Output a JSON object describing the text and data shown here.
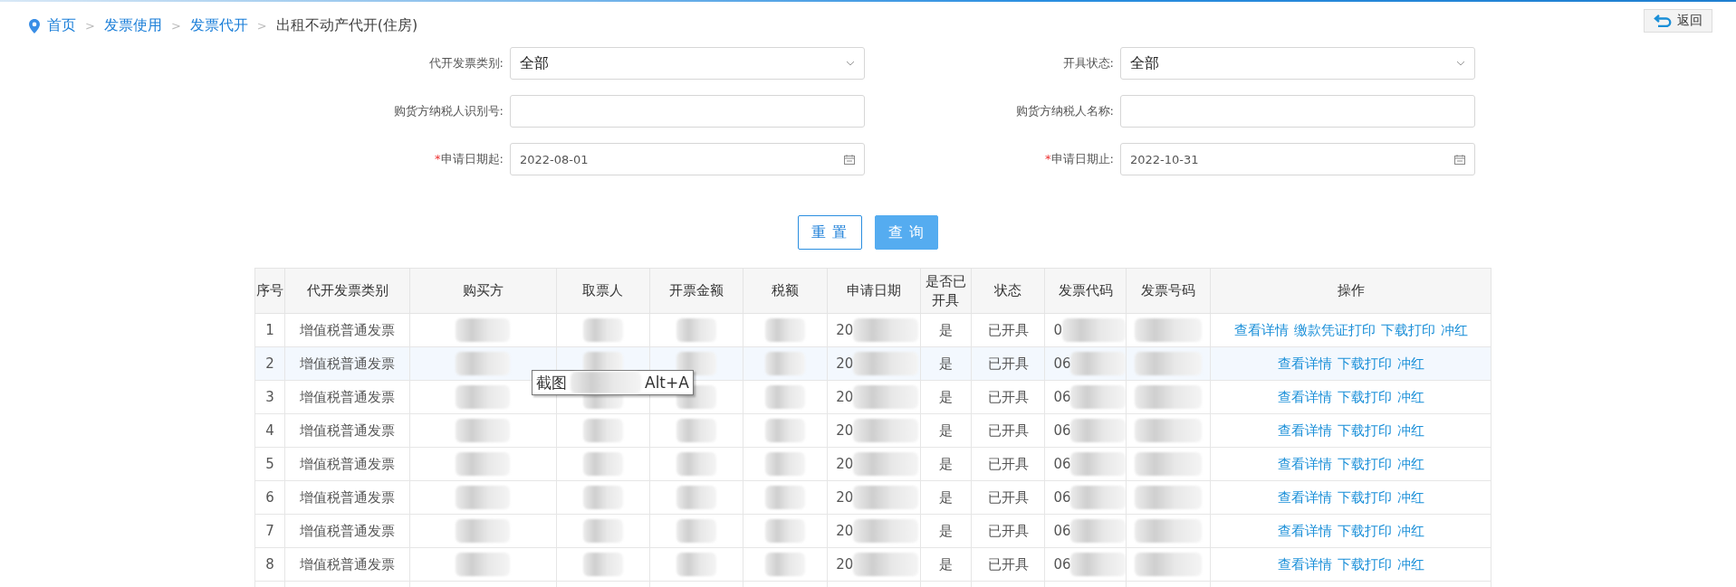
{
  "breadcrumb": [
    {
      "label": "首页",
      "link": true
    },
    {
      "label": "发票使用",
      "link": true
    },
    {
      "label": "发票代开",
      "link": true
    },
    {
      "label": "出租不动产代开(住房)",
      "link": false
    }
  ],
  "separator": ">",
  "back_button": {
    "label": "返回"
  },
  "form": [
    {
      "label": "代开发票类别:",
      "kind": "select",
      "value": "全部",
      "required": false
    },
    {
      "label": "开具状态:",
      "kind": "select",
      "value": "全部",
      "required": false
    },
    {
      "label": "购货方纳税人识别号:",
      "kind": "text",
      "required": false
    },
    {
      "label": "购货方纳税人名称:",
      "kind": "text",
      "required": false
    },
    {
      "label": "申请日期起:",
      "kind": "date",
      "value": "2022-08-01",
      "required": true
    },
    {
      "label": "申请日期止:",
      "kind": "date",
      "value": "2022-10-31",
      "required": true
    }
  ],
  "required_mark": "*",
  "buttons": [
    {
      "label": "重 置",
      "kind": "secondary"
    },
    {
      "label": "查 询",
      "kind": "primary"
    }
  ],
  "table": {
    "columns": [
      "序号",
      "代开发票类别",
      "购买方",
      "取票人",
      "开票金额",
      "税额",
      "申请日期",
      "是否已开具",
      "状态",
      "发票代码",
      "发票号码",
      "操作"
    ],
    "rows": [
      {
        "no": "1",
        "type": "增值税普通发票",
        "date": "20",
        "issued": "是",
        "status": "已开具",
        "code": "0",
        "highlighted": false,
        "actions": [
          "查看详情",
          "缴款凭证打印",
          "下载打印",
          "冲红"
        ]
      },
      {
        "no": "2",
        "type": "增值税普通发票",
        "date": "20",
        "issued": "是",
        "status": "已开具",
        "code": "06",
        "highlighted": true,
        "actions": [
          "查看详情",
          "下载打印",
          "冲红"
        ]
      },
      {
        "no": "3",
        "type": "增值税普通发票",
        "date": "20",
        "issued": "是",
        "status": "已开具",
        "code": "06",
        "highlighted": false,
        "actions": [
          "查看详情",
          "下载打印",
          "冲红"
        ]
      },
      {
        "no": "4",
        "type": "增值税普通发票",
        "date": "20",
        "issued": "是",
        "status": "已开具",
        "code": "06",
        "highlighted": false,
        "actions": [
          "查看详情",
          "下载打印",
          "冲红"
        ]
      },
      {
        "no": "5",
        "type": "增值税普通发票",
        "date": "20",
        "issued": "是",
        "status": "已开具",
        "code": "06",
        "highlighted": false,
        "actions": [
          "查看详情",
          "下载打印",
          "冲红"
        ]
      },
      {
        "no": "6",
        "type": "增值税普通发票",
        "date": "20",
        "issued": "是",
        "status": "已开具",
        "code": "06",
        "highlighted": false,
        "actions": [
          "查看详情",
          "下载打印",
          "冲红"
        ]
      },
      {
        "no": "7",
        "type": "增值税普通发票",
        "date": "20",
        "issued": "是",
        "status": "已开具",
        "code": "06",
        "highlighted": false,
        "actions": [
          "查看详情",
          "下载打印",
          "冲红"
        ]
      },
      {
        "no": "8",
        "type": "增值税普通发票",
        "date": "20",
        "issued": "是",
        "status": "已开具",
        "code": "06",
        "highlighted": false,
        "actions": [
          "查看详情",
          "下载打印",
          "冲红"
        ]
      }
    ]
  },
  "tooltip": {
    "parts": [
      "截图",
      "Alt+A"
    ]
  }
}
